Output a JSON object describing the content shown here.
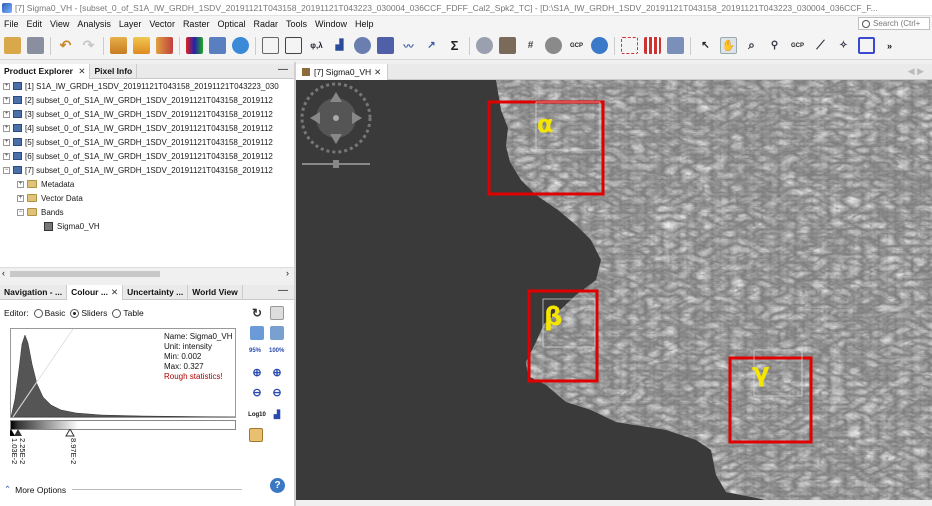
{
  "window": {
    "title": "[7] Sigma0_VH - [subset_0_of_S1A_IW_GRDH_1SDV_20191121T043158_20191121T043223_030004_036CCF_FDFF_Cal2_Spk2_TC] - [D:\\S1A_IW_GRDH_1SDV_20191121T043158_20191121T043223_030004_036CCF_F..."
  },
  "menu": [
    "File",
    "Edit",
    "View",
    "Analysis",
    "Layer",
    "Vector",
    "Raster",
    "Optical",
    "Radar",
    "Tools",
    "Window",
    "Help"
  ],
  "search": {
    "placeholder": "Search (Ctrl+"
  },
  "toolbar": {
    "icons": [
      "open-product-icon",
      "save-icon",
      "undo-icon",
      "redo-icon",
      "band-maths-icon",
      "pin-icon",
      "graph-builder-icon",
      "rgb-window-icon",
      "3d-window-icon",
      "world-wind-icon",
      "polyline-icon",
      "draw-rectangle-icon",
      "phi-lambda-icon",
      "histogram-icon",
      "scatter-icon",
      "profile-plot-icon",
      "spectrum-icon",
      "statistics-icon",
      "sum-icon",
      "mask-manager-icon",
      "layer-icon",
      "grid-icon",
      "gcp-manager-icon",
      "gcp-icon",
      "eye-icon",
      "tie-point-icon",
      "pixel-info-icon",
      "plot-icon",
      "select-tool-icon",
      "pan-tool-icon",
      "zoom-tool-icon",
      "pin-placing-icon",
      "gcp-placing-icon",
      "range-finder-icon",
      "magic-wand-icon",
      "shape-icon",
      "more-icon"
    ],
    "labels": {
      "gcp1": "GCP",
      "gcp2": "GCP",
      "phi": "φ,λ",
      "sum": "Σ"
    }
  },
  "explorer": {
    "tabs": [
      {
        "label": "Product Explorer",
        "closable": true
      },
      {
        "label": "Pixel Info",
        "closable": false
      }
    ],
    "products": [
      "[1] S1A_IW_GRDH_1SDV_20191121T043158_20191121T043223_030",
      "[2] subset_0_of_S1A_IW_GRDH_1SDV_20191121T043158_2019112",
      "[3] subset_0_of_S1A_IW_GRDH_1SDV_20191121T043158_2019112",
      "[4] subset_0_of_S1A_IW_GRDH_1SDV_20191121T043158_2019112",
      "[5] subset_0_of_S1A_IW_GRDH_1SDV_20191121T043158_2019112",
      "[6] subset_0_of_S1A_IW_GRDH_1SDV_20191121T043158_2019112",
      "[7] subset_0_of_S1A_IW_GRDH_1SDV_20191121T043158_2019112"
    ],
    "children": [
      "Metadata",
      "Vector Data",
      "Bands"
    ],
    "band": "Sigma0_VH"
  },
  "tool_panel": {
    "tabs": [
      {
        "label": "Navigation - ...",
        "active": false
      },
      {
        "label": "Colour ...",
        "active": true
      },
      {
        "label": "Uncertainty ...",
        "active": false
      },
      {
        "label": "World View",
        "active": false
      }
    ],
    "editor_label": "Editor:",
    "editor_options": [
      "Basic",
      "Sliders",
      "Table"
    ],
    "editor_selected": "Sliders",
    "info": {
      "name": "Name: Sigma0_VH",
      "unit": "Unit: intensity",
      "min": "Min: 0.002",
      "max": "Max: 0.327",
      "warning": "Rough statistics!"
    },
    "slider_labels": [
      "1.03E-2",
      "2.25E-2",
      "8.97E-2"
    ],
    "side_labels": {
      "percent": "95%",
      "full": "100%",
      "log": "Log10"
    },
    "more_options": "More Options",
    "help": "?"
  },
  "view": {
    "tab_label": "[7] Sigma0_VH",
    "annotations": [
      {
        "label": "α",
        "color": "#e00000"
      },
      {
        "label": "β",
        "color": "#e00000"
      },
      {
        "label": "γ",
        "color": "#e00000"
      }
    ]
  }
}
